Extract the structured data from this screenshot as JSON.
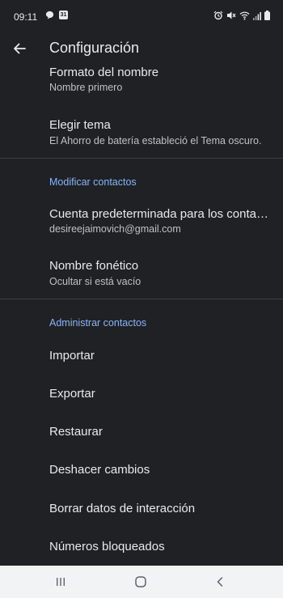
{
  "status_bar": {
    "time": "09:11",
    "left_icons": [
      "chat-icon",
      "calendar-icon"
    ],
    "calendar_day": "31",
    "right_icons": [
      "alarm-icon",
      "mute-icon",
      "wifi-icon",
      "signal-icon",
      "battery-icon"
    ]
  },
  "app_bar": {
    "title": "Configuración"
  },
  "settings": {
    "name_format": {
      "title": "Formato del nombre",
      "subtitle": "Nombre primero"
    },
    "theme": {
      "title": "Elegir tema",
      "subtitle": "El Ahorro de batería estableció el Tema oscuro."
    },
    "modify_header": "Modificar contactos",
    "default_account": {
      "title": "Cuenta predeterminada para los contact..",
      "subtitle": "desireejaimovich@gmail.com"
    },
    "phonetic_name": {
      "title": "Nombre fonético",
      "subtitle": "Ocultar si está vacío"
    },
    "manage_header": "Administrar contactos",
    "manage_items": {
      "import": "Importar",
      "export": "Exportar",
      "restore": "Restaurar",
      "undo": "Deshacer cambios",
      "clear": "Borrar datos de interacción",
      "blocked": "Números bloqueados"
    }
  },
  "nav_bar": {
    "recents_icon": "recents-icon",
    "home_icon": "home-icon",
    "back_icon": "back-nav-icon"
  }
}
